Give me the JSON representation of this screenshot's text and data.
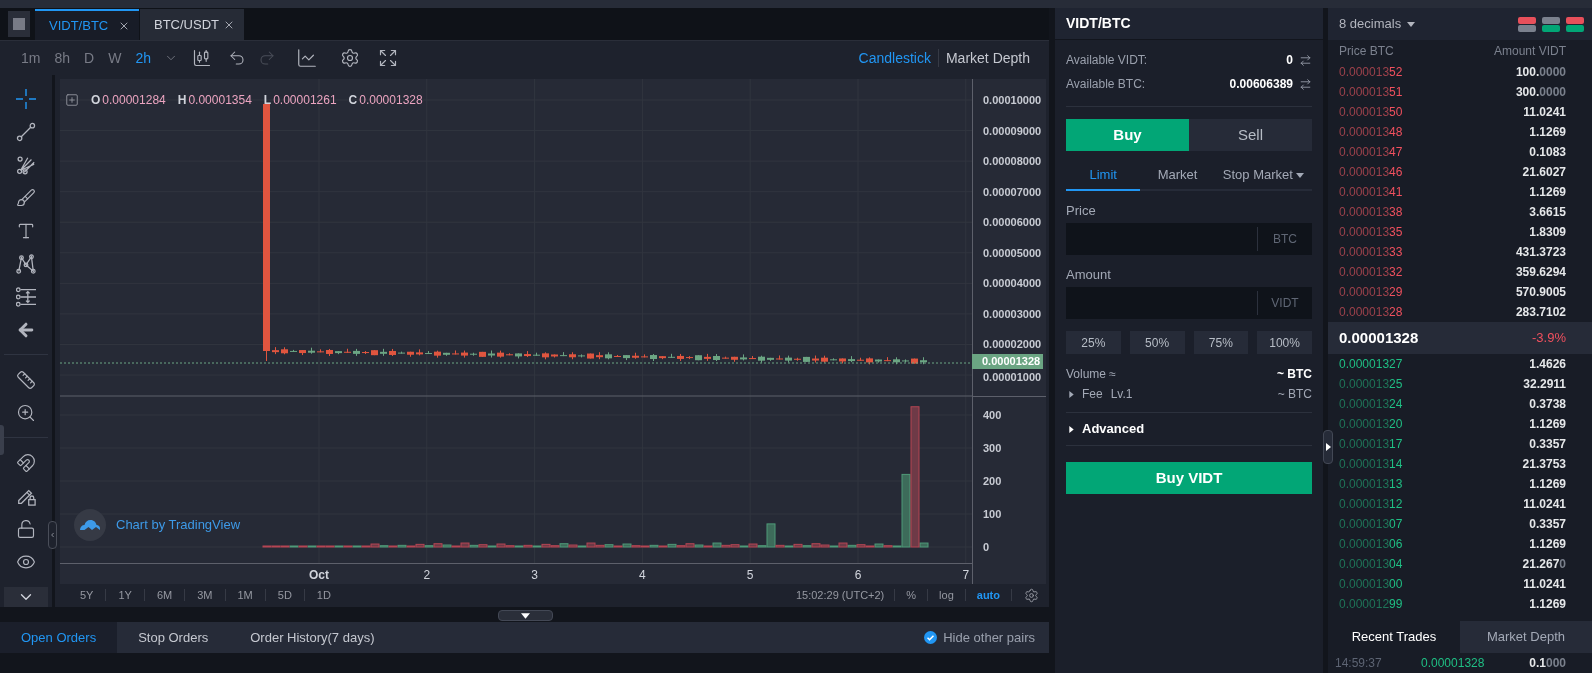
{
  "chart_tabs": [
    {
      "label": "VIDT/BTC",
      "selected": true
    },
    {
      "label": "BTC/USDT",
      "selected": false
    }
  ],
  "chart_toolbar": {
    "intervals": [
      {
        "label": "1m",
        "selected": false
      },
      {
        "label": "8h",
        "selected": false
      },
      {
        "label": "D",
        "selected": false
      },
      {
        "label": "W",
        "selected": false
      },
      {
        "label": "2h",
        "selected": true
      }
    ],
    "undo": {
      "disabled": false
    },
    "redo": {
      "disabled": true
    },
    "chart_types": [
      {
        "label": "Candlestick",
        "selected": true
      },
      {
        "label": "Market Depth",
        "selected": false
      }
    ]
  },
  "drawing_tools": [
    {
      "selected": true
    },
    {
      "selected": false
    },
    {
      "selected": false
    },
    {
      "selected": false
    },
    {
      "selected": false
    },
    {
      "selected": false
    },
    {
      "selected": false
    },
    {
      "selected": false
    },
    {
      "selected": false
    },
    {
      "selected": false
    },
    {
      "selected": false
    },
    {
      "selected": false
    },
    {
      "selected": false
    },
    {
      "selected": false
    }
  ],
  "chart": {
    "legend": [
      {
        "label": "O",
        "value": "0.00001284"
      },
      {
        "label": "H",
        "value": "0.00001354"
      },
      {
        "label": "L",
        "value": "0.00001261"
      },
      {
        "label": "C",
        "value": "0.00001328"
      }
    ],
    "price_ticks": [
      "0.00010000",
      "0.00009000",
      "0.00008000",
      "0.00007000",
      "0.00006000",
      "0.00005000",
      "0.00004000",
      "0.00003000",
      "0.00002000",
      "0.00001000"
    ],
    "last_price": "0.00001328",
    "volume_ticks": [
      "400",
      "300",
      "200",
      "100",
      "0"
    ],
    "time_labels": [
      "Oct",
      "2",
      "3",
      "4",
      "5",
      "6",
      "7"
    ],
    "attribution": "Chart by TradingView"
  },
  "range_bar": {
    "ranges": [
      "5Y",
      "1Y",
      "6M",
      "3M",
      "1M",
      "5D",
      "1D"
    ],
    "clock": "15:02:29 (UTC+2)",
    "scale_options": [
      {
        "label": "%",
        "selected": false
      },
      {
        "label": "log",
        "selected": false
      },
      {
        "label": "auto",
        "selected": true
      }
    ]
  },
  "orders_panel": {
    "tabs": [
      {
        "label": "Open Orders",
        "selected": true
      },
      {
        "label": "Stop Orders",
        "selected": false
      },
      {
        "label": "Order History(7 days)",
        "selected": false
      }
    ],
    "hide_other_pairs": {
      "label": "Hide other pairs",
      "checked": true
    }
  },
  "order_form": {
    "title": "VIDT/BTC",
    "balances": [
      {
        "label": "Available VIDT:",
        "value": "0"
      },
      {
        "label": "Available BTC:",
        "value": "0.00606389"
      }
    ],
    "sides": [
      {
        "label": "Buy",
        "selected": true
      },
      {
        "label": "Sell",
        "selected": false
      }
    ],
    "order_types": [
      {
        "label": "Limit",
        "selected": true,
        "dropdown": false
      },
      {
        "label": "Market",
        "selected": false,
        "dropdown": false
      },
      {
        "label": "Stop Market",
        "selected": false,
        "dropdown": true
      }
    ],
    "fields": [
      {
        "label": "Price",
        "unit": "BTC"
      },
      {
        "label": "Amount",
        "unit": "VIDT"
      }
    ],
    "percentages": [
      "25%",
      "50%",
      "75%",
      "100%"
    ],
    "volume": {
      "label": "Volume ≈",
      "value": "~ BTC"
    },
    "fee": {
      "label": "Fee",
      "level": "Lv.1",
      "value": "~ BTC",
      "expanded": false
    },
    "advanced": {
      "label": "Advanced",
      "expanded": false
    },
    "submit": "Buy VIDT"
  },
  "order_book": {
    "precision": "8 decimals",
    "columns": [
      "Price BTC",
      "Amount VIDT"
    ],
    "asks": [
      {
        "price_head": "0.000013",
        "price_tail": "52",
        "amount": "100.",
        "amount_dim": "0000"
      },
      {
        "price_head": "0.000013",
        "price_tail": "51",
        "amount": "300.",
        "amount_dim": "0000"
      },
      {
        "price_head": "0.000013",
        "price_tail": "50",
        "amount": "11.0241"
      },
      {
        "price_head": "0.000013",
        "price_tail": "48",
        "amount": "1.1269"
      },
      {
        "price_head": "0.000013",
        "price_tail": "47",
        "amount": "0.1083"
      },
      {
        "price_head": "0.000013",
        "price_tail": "46",
        "amount": "21.6027"
      },
      {
        "price_head": "0.000013",
        "price_tail": "41",
        "amount": "1.1269"
      },
      {
        "price_head": "0.000013",
        "price_tail": "38",
        "amount": "3.6615"
      },
      {
        "price_head": "0.000013",
        "price_tail": "35",
        "amount": "1.8309"
      },
      {
        "price_head": "0.000013",
        "price_tail": "33",
        "amount": "431.3723"
      },
      {
        "price_head": "0.000013",
        "price_tail": "32",
        "amount": "359.6294"
      },
      {
        "price_head": "0.000013",
        "price_tail": "29",
        "amount": "570.9005"
      },
      {
        "price_head": "0.000013",
        "price_tail": "28",
        "amount": "283.7102"
      }
    ],
    "last_trade": {
      "price": "0.00001328",
      "change": "-3.9%"
    },
    "bids": [
      {
        "price_tail": "0.00001327",
        "amount": "1.4626"
      },
      {
        "price_head": "0.000013",
        "price_tail": "25",
        "amount": "32.2911"
      },
      {
        "price_head": "0.000013",
        "price_tail": "24",
        "amount": "0.3738"
      },
      {
        "price_head": "0.000013",
        "price_tail": "20",
        "amount": "1.1269"
      },
      {
        "price_head": "0.000013",
        "price_tail": "17",
        "amount": "0.3357"
      },
      {
        "price_head": "0.000013",
        "price_tail": "14",
        "amount": "21.3753"
      },
      {
        "price_head": "0.000013",
        "price_tail": "13",
        "amount": "1.1269"
      },
      {
        "price_head": "0.000013",
        "price_tail": "12",
        "amount": "11.0241"
      },
      {
        "price_head": "0.000013",
        "price_tail": "07",
        "amount": "0.3357"
      },
      {
        "price_head": "0.000013",
        "price_tail": "06",
        "amount": "1.1269"
      },
      {
        "price_head": "0.000013",
        "price_tail": "04",
        "amount": "21.267",
        "amount_dim": "0"
      },
      {
        "price_head": "0.000013",
        "price_tail": "00",
        "amount": "11.0241"
      },
      {
        "price_head": "0.000012",
        "price_tail": "99",
        "amount": "1.1269"
      }
    ]
  },
  "trades_panel": {
    "tabs": [
      {
        "label": "Recent Trades",
        "selected": true
      },
      {
        "label": "Market Depth",
        "selected": false
      }
    ],
    "trades": [
      {
        "time": "14:59:37",
        "price": "0.00001328",
        "amount": "0.1",
        "amount_dim": "000"
      }
    ]
  }
}
